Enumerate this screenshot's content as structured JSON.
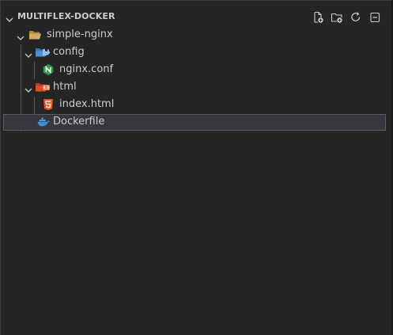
{
  "explorer": {
    "section_title": "MULTIFLEX-DOCKER",
    "actions": [
      {
        "name": "new-file-icon",
        "label": "New File"
      },
      {
        "name": "new-folder-icon",
        "label": "New Folder"
      },
      {
        "name": "refresh-icon",
        "label": "Refresh Explorer"
      },
      {
        "name": "collapse-all-icon",
        "label": "Collapse Folders in Explorer"
      }
    ],
    "tree": [
      {
        "label": "simple-nginx",
        "type": "folder",
        "expanded": true,
        "depth": 0,
        "icon": "folder-open-icon"
      },
      {
        "label": "config",
        "type": "folder",
        "expanded": true,
        "depth": 1,
        "icon": "folder-docker-icon"
      },
      {
        "label": "nginx.conf",
        "type": "file",
        "depth": 2,
        "icon": "nginx-icon"
      },
      {
        "label": "html",
        "type": "folder",
        "expanded": true,
        "depth": 1,
        "icon": "folder-html-icon"
      },
      {
        "label": "index.html",
        "type": "file",
        "depth": 2,
        "icon": "html5-icon"
      },
      {
        "label": "Dockerfile",
        "type": "file",
        "depth": 1,
        "icon": "docker-icon",
        "selected": true
      }
    ]
  },
  "colors": {
    "background": "#252526",
    "text": "#cccccc",
    "selection": "#37373d",
    "nginx": "#2e9a47",
    "html5": "#e44d26",
    "docker": "#3c8fd6",
    "folder": "#c9a25c"
  }
}
